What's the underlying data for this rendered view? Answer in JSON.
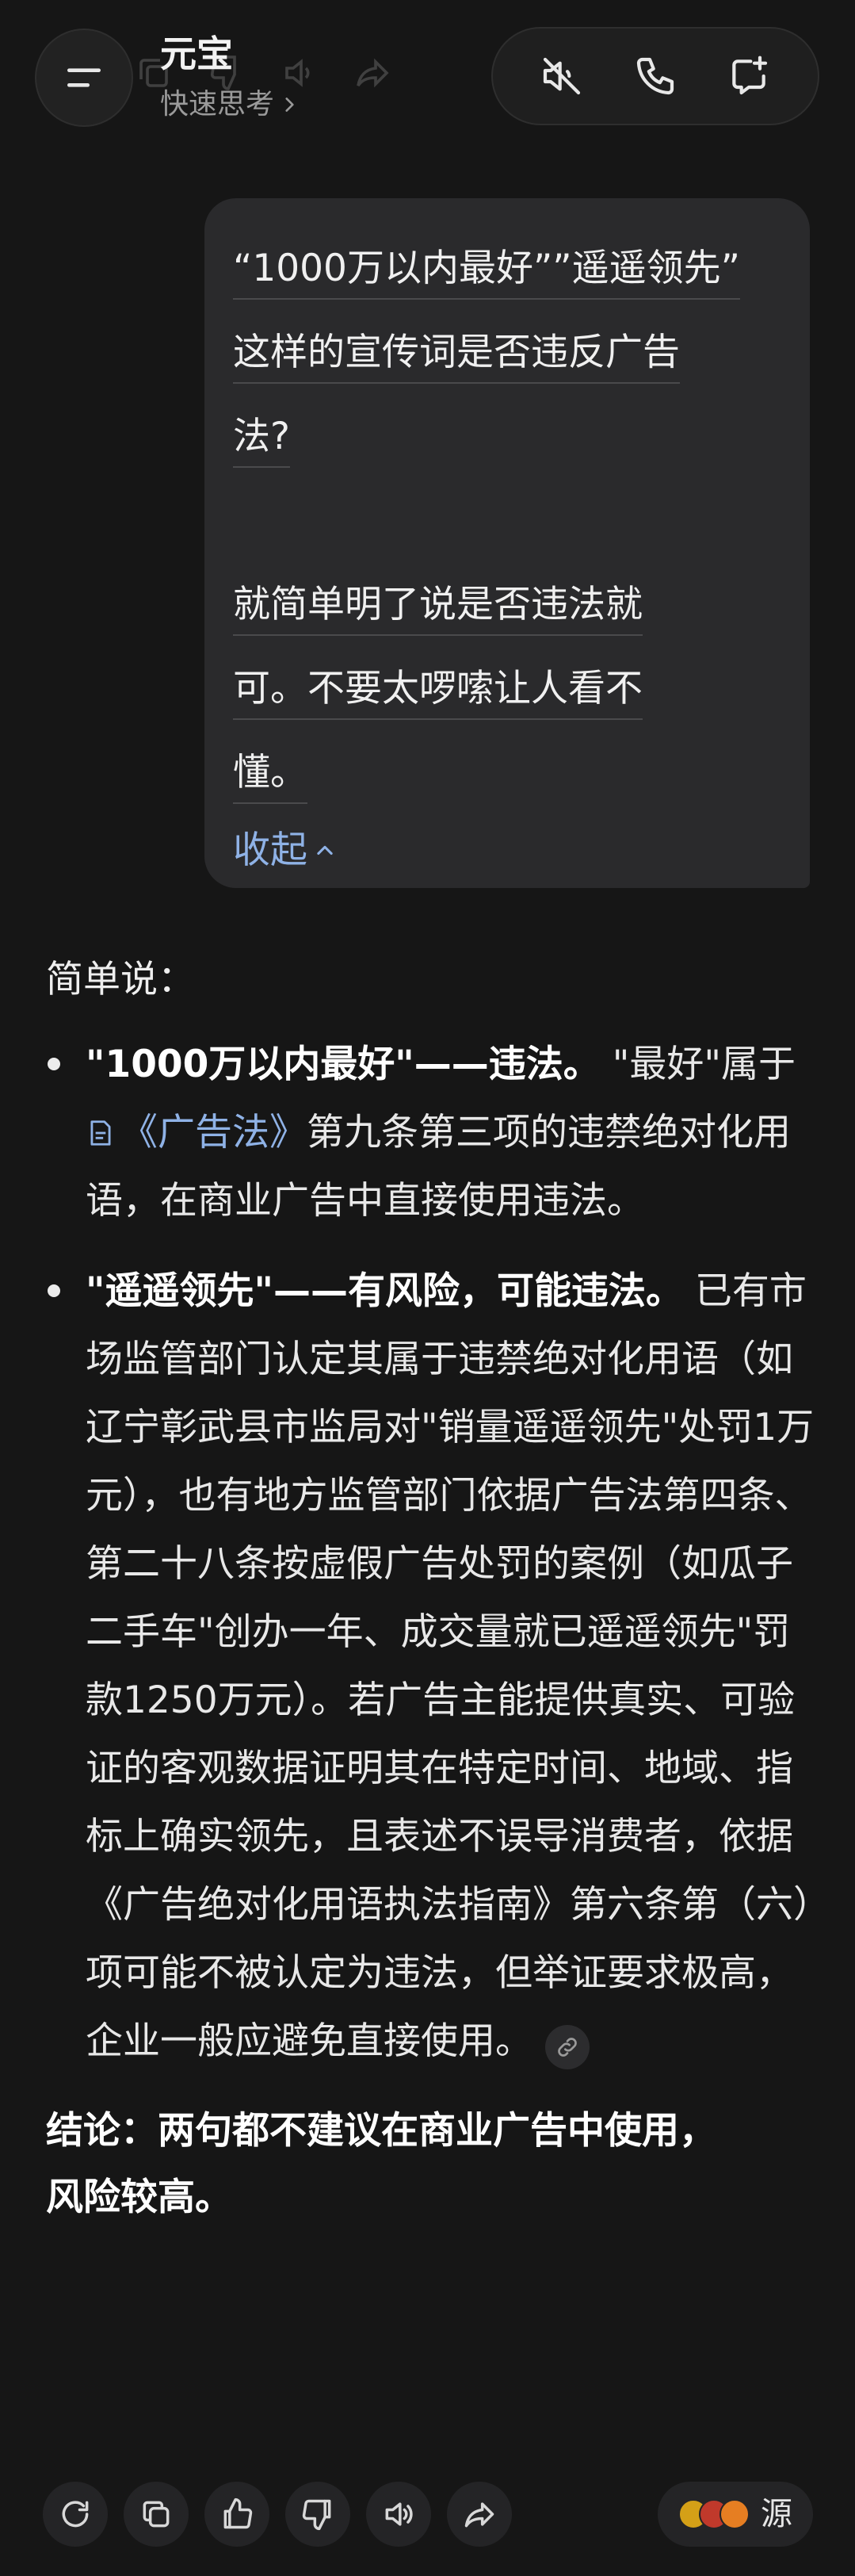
{
  "header": {
    "title": "元宝",
    "mode": "快速思考"
  },
  "user_message": {
    "lines": [
      "“1000万以内最好””遥遥领先”",
      "这样的宣传词是否违反广告",
      "法?",
      "",
      "就简单明了说是否违法就",
      "可。不要太啰嗦让人看不",
      "懂。"
    ],
    "collapse_label": "收起"
  },
  "answer": {
    "intro": "简单说：",
    "bullet1": {
      "bold": "\"1000万以内最好\"——违法。",
      "text_a": " \"最好\"属于",
      "law_link": "《广告法》",
      "text_b": "第九条第三项的违禁绝对化用语，在商业广告中直接使用违法。"
    },
    "bullet2": {
      "bold": "\"遥遥领先\"——有风险，可能违法。",
      "text": " 已有市场监管部门认定其属于违禁绝对化用语（如辽宁彰武县市监局对\"销量遥遥领先\"处罚1万元），也有地方监管部门依据广告法第四条、第二十八条按虚假广告处罚的案例（如瓜子二手车\"创办一年、成交量就已遥遥领先\"罚款1250万元）。若广告主能提供真实、可验证的客观数据证明其在特定时间、地域、指标上确实领先，且表述不误导消费者，依据《广告绝对化用语执法指南》第六条第（六）项可能不被认定为违法，但举证要求极高，企业一般应避免直接使用。"
    },
    "conclusion": "结论：两句都不建议在商业广告中使用，\n风险较高。"
  },
  "footer": {
    "source_label": "源",
    "source_colors": [
      "#d4a017",
      "#c0392b",
      "#e67e22"
    ]
  },
  "colors": {
    "background": "#161616",
    "bubble": "#2a2a2c",
    "link": "#8fb2e6"
  }
}
